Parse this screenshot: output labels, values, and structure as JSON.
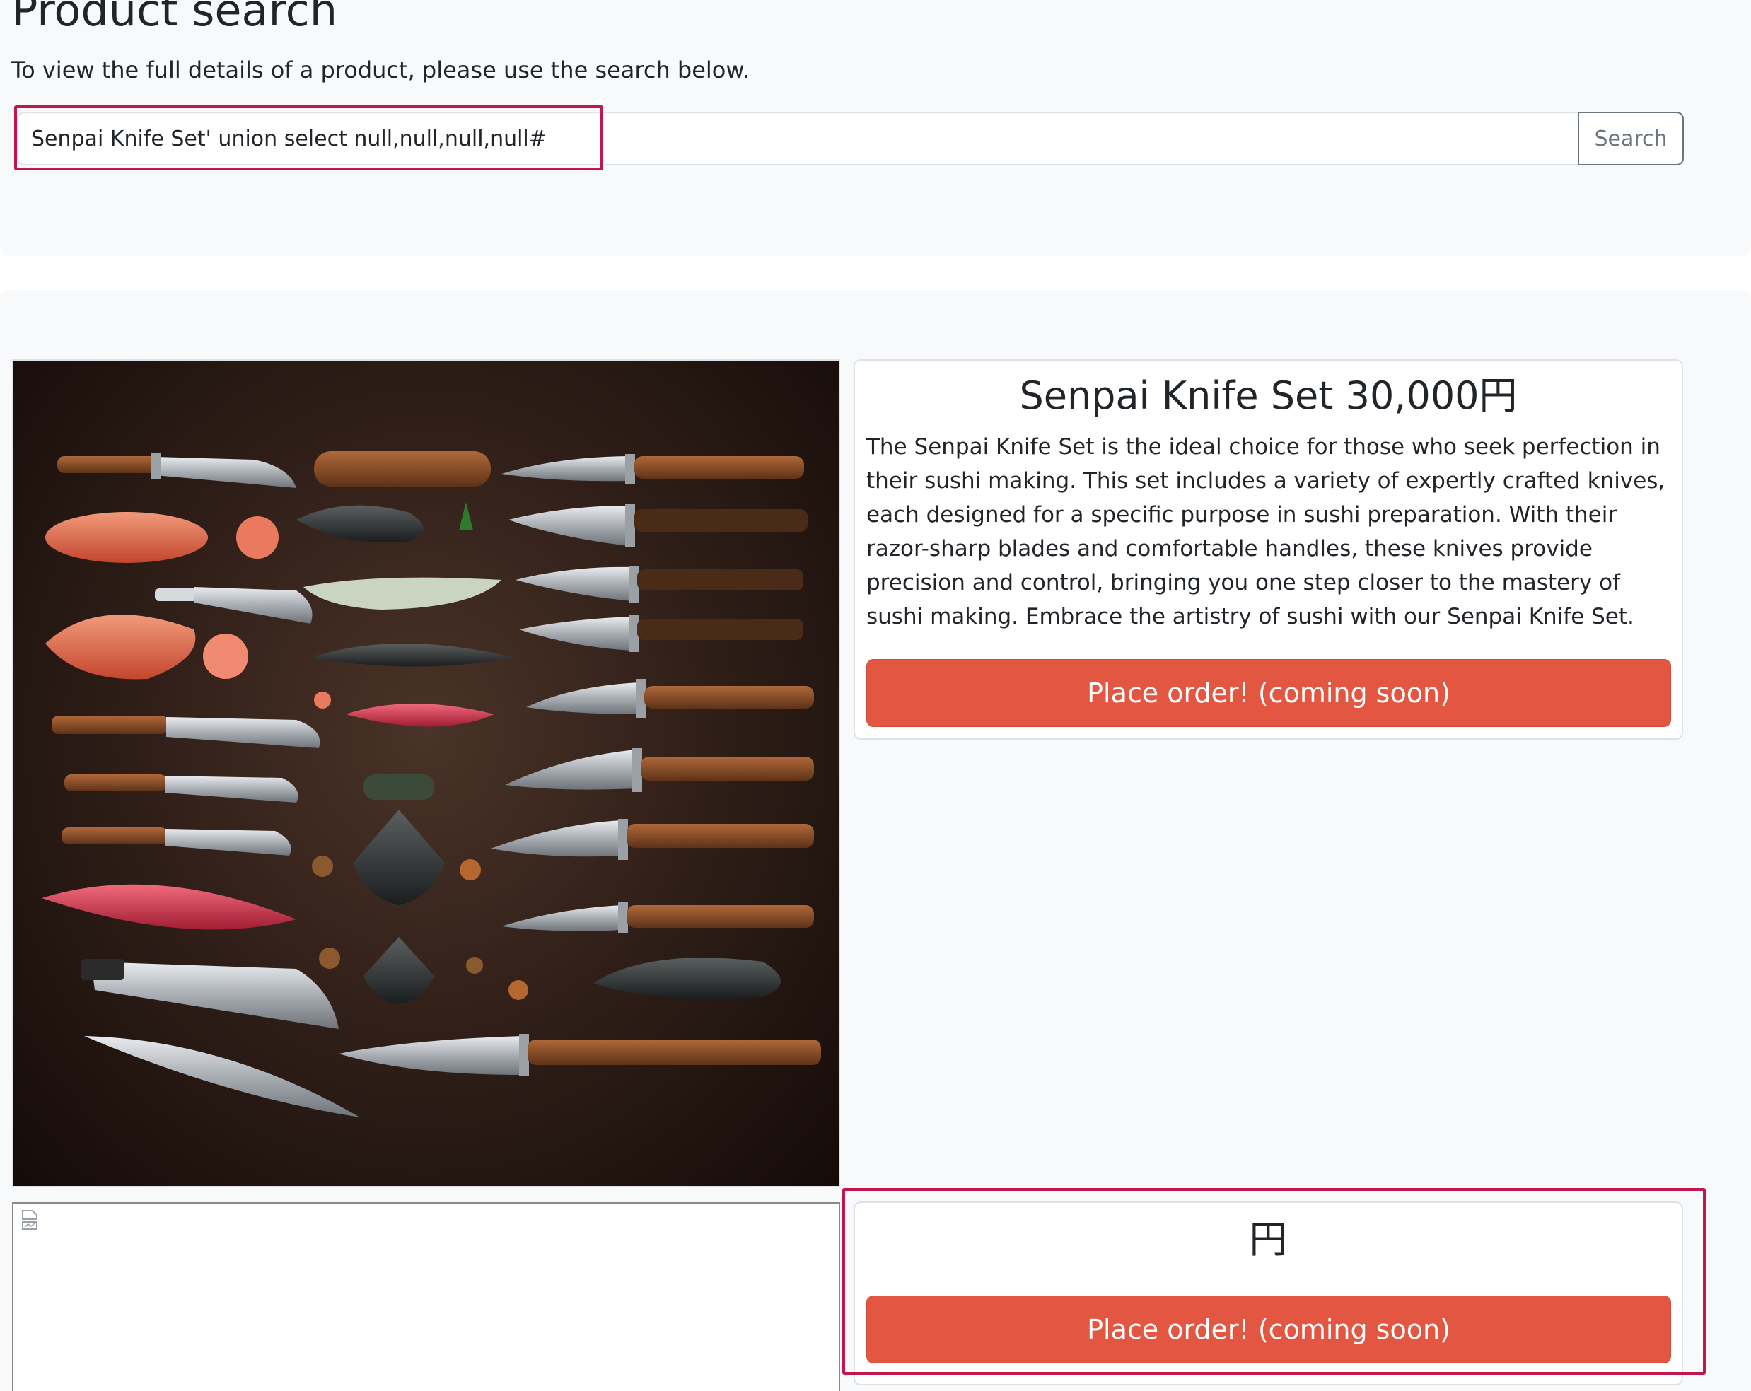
{
  "search": {
    "title": "Product search",
    "hint": "To view the full details of a product, please use the search below.",
    "input_value": "Senpai Knife Set' union select null,null,null,null#",
    "button_label": "Search"
  },
  "colors": {
    "annotation_highlight": "#c0184b",
    "order_button": "#e35642",
    "section_background": "#f8f9fa"
  },
  "results": [
    {
      "title": "Senpai Knife Set 30,000円",
      "description": "The Senpai Knife Set is the ideal choice for those who seek perfection in their sushi making. This set includes a variety of expertly crafted knives, each designed for a specific purpose in sushi preparation. With their razor-sharp blades and comfortable handles, these knives provide precision and control, bringing you one step closer to the mastery of sushi making. Embrace the artistry of sushi with our Senpai Knife Set.",
      "order_label": "Place order! (coming soon)",
      "image": "knives-and-sushi-photo"
    },
    {
      "title": "円",
      "description": "",
      "order_label": "Place order! (coming soon)",
      "image": "broken-image-icon"
    }
  ]
}
